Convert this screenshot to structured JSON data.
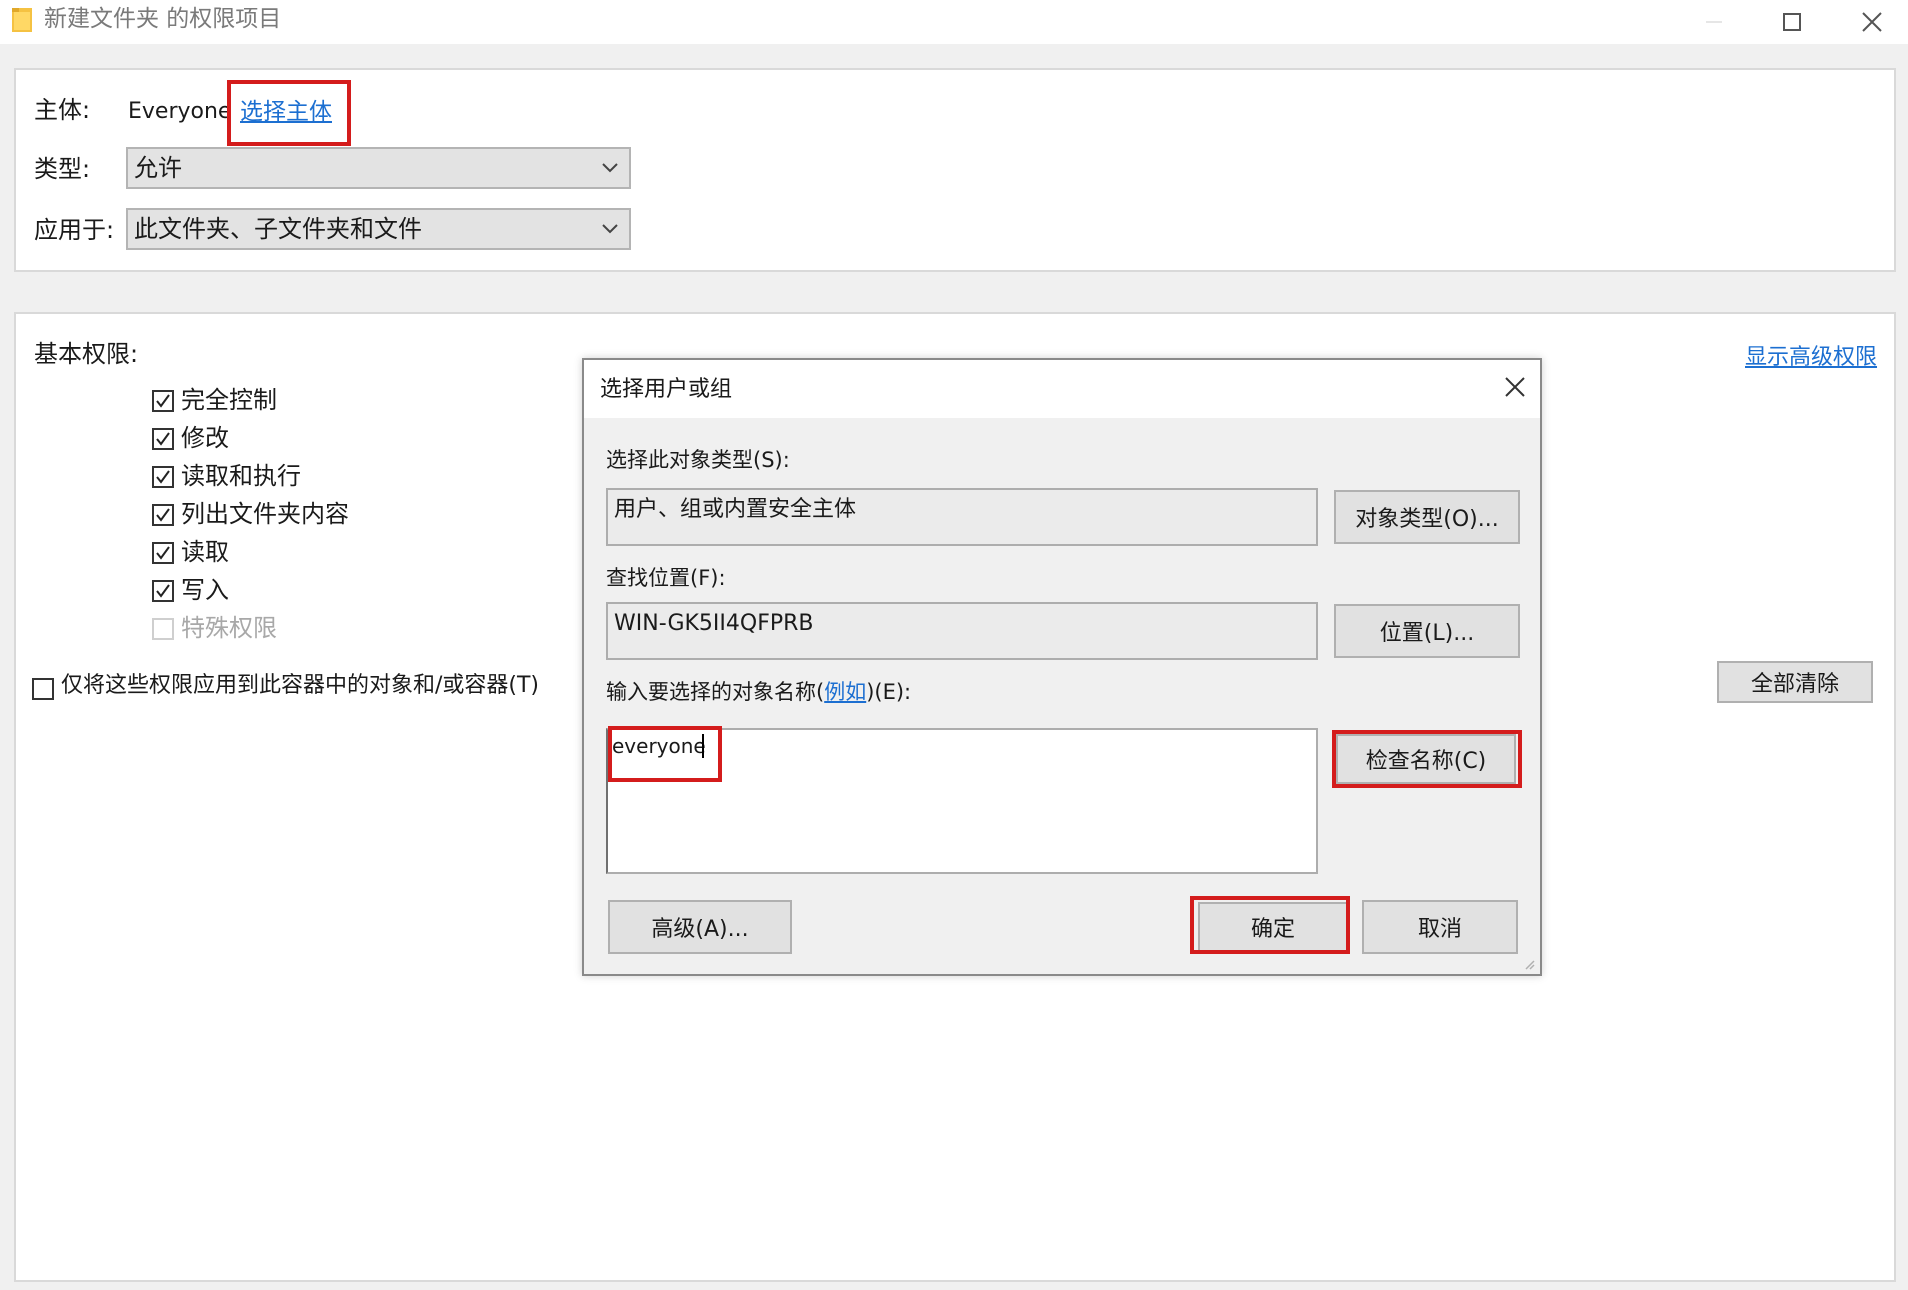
{
  "window": {
    "title": "新建文件夹 的权限项目",
    "icon": "folder-icon"
  },
  "principal": {
    "label": "主体:",
    "value": "Everyone",
    "select_link": "选择主体"
  },
  "type": {
    "label": "类型:",
    "value": "允许"
  },
  "applies_to": {
    "label": "应用于:",
    "value": "此文件夹、子文件夹和文件"
  },
  "basic_permissions": {
    "heading": "基本权限:",
    "show_advanced": "显示高级权限",
    "items": [
      {
        "label": "完全控制",
        "checked": true,
        "enabled": true
      },
      {
        "label": "修改",
        "checked": true,
        "enabled": true
      },
      {
        "label": "读取和执行",
        "checked": true,
        "enabled": true
      },
      {
        "label": "列出文件夹内容",
        "checked": true,
        "enabled": true
      },
      {
        "label": "读取",
        "checked": true,
        "enabled": true
      },
      {
        "label": "写入",
        "checked": true,
        "enabled": true
      },
      {
        "label": "特殊权限",
        "checked": false,
        "enabled": false
      }
    ],
    "apply_only_label": "仅将这些权限应用到此容器中的对象和/或容器(T)",
    "apply_only_checked": false,
    "clear_all": "全部清除"
  },
  "dialog": {
    "title": "选择用户或组",
    "object_type_label": "选择此对象类型(S):",
    "object_type_value": "用户、组或内置安全主体",
    "object_types_button": "对象类型(O)...",
    "location_label": "查找位置(F):",
    "location_value": "WIN-GK5II4QFPRB",
    "locations_button": "位置(L)...",
    "names_label_prefix": "输入要选择的对象名称(",
    "names_label_link": "例如",
    "names_label_suffix": ")(E):",
    "names_value": "everyone",
    "check_names_button": "检查名称(C)",
    "advanced_button": "高级(A)...",
    "ok_button": "确定",
    "cancel_button": "取消"
  },
  "colors": {
    "highlight": "#d41c1c",
    "link": "#1c6fd1"
  }
}
